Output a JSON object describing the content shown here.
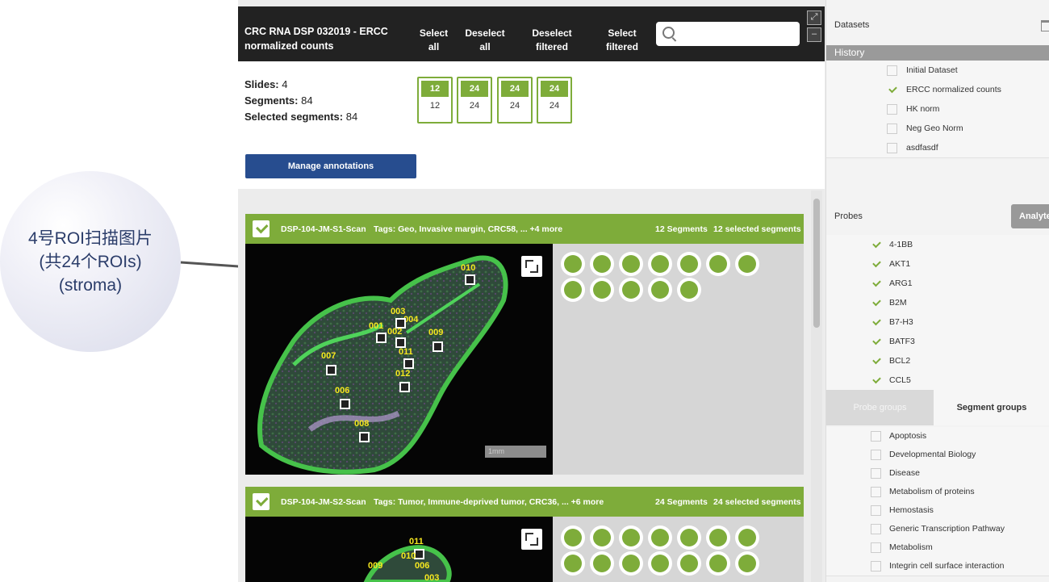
{
  "callout": {
    "lines": [
      "4号ROI扫描图片",
      "(共24个ROIs)",
      "(stroma)"
    ]
  },
  "toolbar": {
    "title": "CRC RNA DSP 032019 - ERCC normalized counts",
    "buttons": [
      "Select all",
      "Deselect all",
      "Deselect filtered",
      "Select filtered"
    ],
    "search_placeholder": ""
  },
  "summary": {
    "slides_label": "Slides:",
    "slides_value": "4",
    "segments_label": "Segments:",
    "segments_value": "84",
    "selected_label": "Selected segments:",
    "selected_value": "84",
    "slide_boxes": [
      {
        "top": "12",
        "bottom": "12"
      },
      {
        "top": "24",
        "bottom": "24"
      },
      {
        "top": "24",
        "bottom": "24"
      },
      {
        "top": "24",
        "bottom": "24"
      }
    ]
  },
  "manage_annotations": "Manage annotations",
  "scans": [
    {
      "name": "DSP-104-JM-S1-Scan",
      "tags": "Tags: Geo,  Invasive margin,  CRC58,  ... +4 more",
      "segments": "12 Segments",
      "selected": "12 selected segments",
      "rois": [
        "010",
        "003",
        "004",
        "001",
        "002",
        "009",
        "011",
        "007",
        "012",
        "006",
        "008"
      ],
      "scale": "1mm"
    },
    {
      "name": "DSP-104-JM-S2-Scan",
      "tags": "Tags: Tumor,  Immune-deprived tumor,  CRC36,  ... +6 more",
      "segments": "24 Segments",
      "selected": "24 selected segments",
      "rois": [
        "011",
        "010",
        "006",
        "009",
        "003"
      ]
    }
  ],
  "right_panel": {
    "datasets_label": "Datasets",
    "history_label": "History",
    "history": [
      {
        "label": "Initial Dataset",
        "checked": false
      },
      {
        "label": "ERCC normalized counts",
        "checked": true
      },
      {
        "label": "HK norm",
        "checked": false
      },
      {
        "label": "Neg Geo Norm",
        "checked": false
      },
      {
        "label": "asdfasdf",
        "checked": false
      }
    ],
    "probes_label": "Probes",
    "analyte_button": "Analyte",
    "probes": [
      "4-1BB",
      "AKT1",
      "ARG1",
      "B2M",
      "B7-H3",
      "BATF3",
      "BCL2",
      "CCL5"
    ],
    "tabs": [
      "Probe groups",
      "Segment groups"
    ],
    "groups": [
      "Apoptosis",
      "Developmental Biology",
      "Disease",
      "Metabolism of proteins",
      "Hemostasis",
      "Generic Transcription Pathway",
      "Metabolism",
      "Integrin cell surface interaction"
    ]
  },
  "colors": {
    "accent_green": "#7eac3a",
    "toolbar_dark": "#222222",
    "button_blue": "#274d8f",
    "callout_text": "#2b3d6a"
  }
}
